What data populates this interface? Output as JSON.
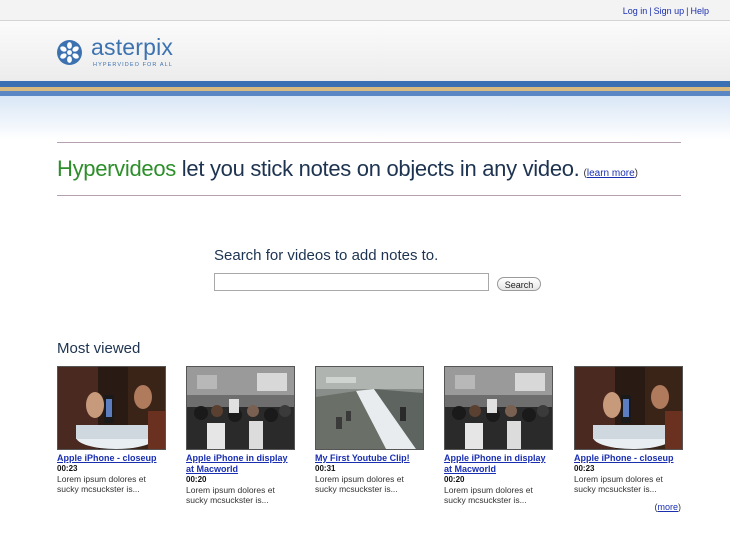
{
  "top_links": {
    "login": "Log in",
    "signup": "Sign up",
    "help": "Help",
    "separator": "|"
  },
  "logo": {
    "name": "asterpix",
    "tagline": "HYPERVIDEO FOR ALL"
  },
  "hero": {
    "highlight": "Hypervideos",
    "rest": " let you stick notes on objects in any video.",
    "learn_open": "(",
    "learn_more": "learn more",
    "learn_close": ")"
  },
  "search": {
    "heading": "Search for videos to add notes to.",
    "value": "",
    "button": "Search"
  },
  "most_viewed": {
    "heading": "Most viewed",
    "videos": [
      {
        "title": "Apple iPhone - closeup",
        "duration": "00:23",
        "desc": "Lorem ipsum dolores et sucky mcsuckster is..."
      },
      {
        "title": "Apple iPhone in display at Macworld",
        "duration": "00:20",
        "desc": "Lorem ipsum dolores et sucky mcsuckster is..."
      },
      {
        "title": "My First Youtube Clip!",
        "duration": "00:31",
        "desc": "Lorem ipsum dolores et sucky mcsuckster is..."
      },
      {
        "title": "Apple iPhone in display at Macworld",
        "duration": "00:20",
        "desc": "Lorem ipsum dolores et sucky mcsuckster is..."
      },
      {
        "title": "Apple iPhone - closeup",
        "duration": "00:23",
        "desc": "Lorem ipsum dolores et sucky mcsuckster is..."
      }
    ],
    "more_open": "(",
    "more": "more",
    "more_close": ")"
  },
  "colors": {
    "brand_blue": "#3d72b0",
    "highlight_green": "#2d8f2a",
    "link_blue": "#1a2fb0"
  }
}
